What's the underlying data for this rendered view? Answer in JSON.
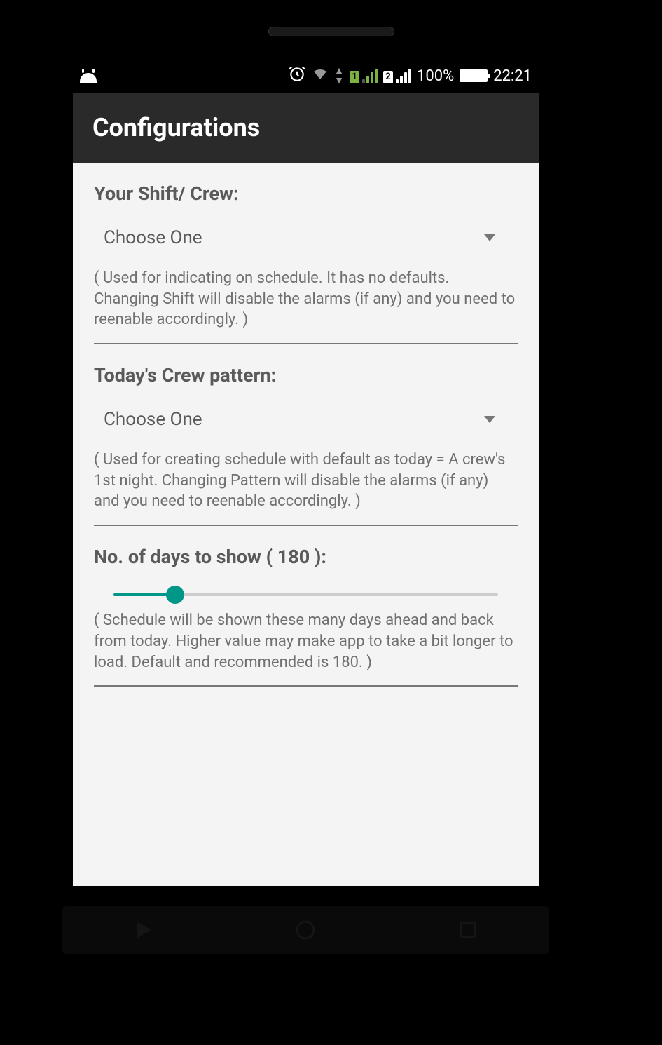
{
  "status": {
    "battery_pct": "100%",
    "time": "22:21"
  },
  "header": {
    "title": "Configurations"
  },
  "sections": {
    "shift": {
      "label": "Your Shift/ Crew:",
      "dropdown_value": "Choose One",
      "help": "( Used for indicating on schedule. It has no defaults. Changing Shift will disable the alarms (if any) and you need to reenable accordingly. )"
    },
    "pattern": {
      "label": "Today's Crew pattern:",
      "dropdown_value": "Choose One",
      "help": "( Used for creating schedule with default as today = A crew's 1st night. Changing Pattern will disable the alarms (if any) and you need to reenable accordingly. )"
    },
    "days": {
      "label": "No. of days to show ( 180 ):",
      "value": 180,
      "help": "( Schedule will be shown these many days ahead and back from today. Higher value may make app to take a bit longer to load. Default and recommended is 180. )"
    }
  }
}
